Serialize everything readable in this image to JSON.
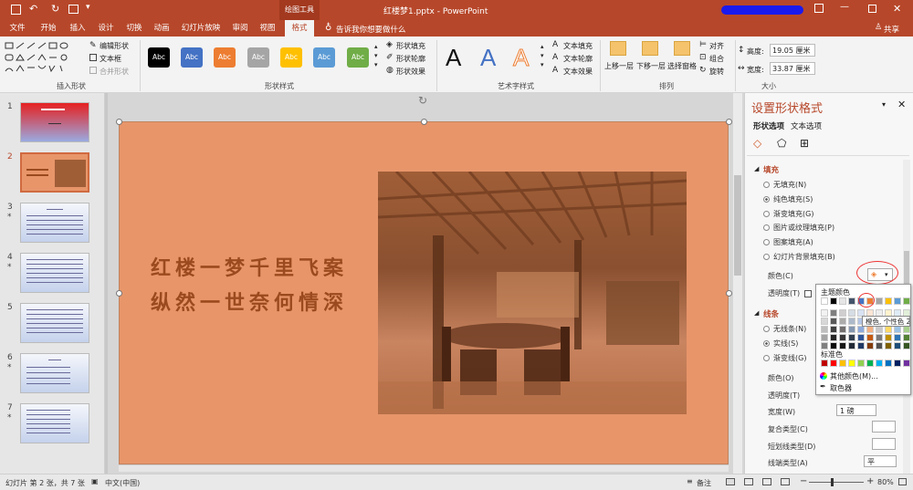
{
  "titlebar": {
    "context_tab": "绘图工具",
    "doc_title": "红楼梦1.pptx - PowerPoint",
    "sign_in": "",
    "restore_label": "大小"
  },
  "tabs": [
    {
      "label": "文件"
    },
    {
      "label": "开始"
    },
    {
      "label": "插入"
    },
    {
      "label": "设计"
    },
    {
      "label": "切换"
    },
    {
      "label": "动画"
    },
    {
      "label": "幻灯片放映"
    },
    {
      "label": "审阅"
    },
    {
      "label": "视图"
    },
    {
      "label": "格式"
    }
  ],
  "tell_me": "告诉我你想要做什么",
  "share": "共享",
  "ribbon": {
    "insert_shapes": {
      "label": "插入形状",
      "edit_shape": "编辑形状",
      "text_box": "文本框",
      "merge_shapes": "合并形状"
    },
    "shape_styles": {
      "label": "形状样式",
      "swatch_text": "Abc",
      "fill": "形状填充",
      "outline": "形状轮廓",
      "effects": "形状效果"
    },
    "wordart": {
      "label": "艺术字样式",
      "letter": "A",
      "text_fill": "文本填充",
      "text_outline": "文本轮廓",
      "text_effects": "文本效果"
    },
    "arrange": {
      "label": "排列",
      "bring_forward": "上移一层",
      "send_backward": "下移一层",
      "selection_pane": "选择窗格",
      "align": "对齐",
      "group": "组合",
      "rotate": "旋转"
    },
    "size": {
      "label": "大小",
      "height_label": "高度:",
      "height_value": "19.05 厘米",
      "width_label": "宽度:",
      "width_value": "33.87 厘米"
    }
  },
  "slides": [
    {
      "num": "1",
      "star": ""
    },
    {
      "num": "2",
      "star": ""
    },
    {
      "num": "3",
      "star": "*"
    },
    {
      "num": "4",
      "star": "*"
    },
    {
      "num": "5",
      "star": ""
    },
    {
      "num": "6",
      "star": "*"
    },
    {
      "num": "7",
      "star": "*"
    }
  ],
  "slide_content": {
    "line1": "红楼一梦千里飞案",
    "line2": "纵然一世奈何情深"
  },
  "format_pane": {
    "title": "设置形状格式",
    "tab_shape": "形状选项",
    "tab_text": "文本选项",
    "fill_section": "填充",
    "fill_options": [
      "无填充(N)",
      "纯色填充(S)",
      "渐变填充(G)",
      "图片或纹理填充(P)",
      "图案填充(A)",
      "幻灯片背景填充(B)"
    ],
    "color_label": "颜色(C)",
    "transparency_label": "透明度(T)",
    "line_section": "线条",
    "line_options": [
      "无线条(N)",
      "实线(S)",
      "渐变线(G)"
    ],
    "line_color_label": "颜色(O)",
    "line_transparency_label": "透明度(T)",
    "width_label": "宽度(W)",
    "width_value": "1 磅",
    "compound_label": "复合类型(C)",
    "dash_label": "短划线类型(D)",
    "cap_label": "线端类型(A)",
    "cap_value": "平"
  },
  "color_popup": {
    "theme_label": "主题颜色",
    "tooltip": "橙色, 个性色 2",
    "standard_label": "标准色",
    "more_colors": "其他颜色(M)...",
    "eyedropper": "取色器"
  },
  "statusbar": {
    "slide_info": "幻灯片 第 2 张，共 7 张",
    "language": "中文(中国)",
    "notes": "备注",
    "zoom": "80%"
  },
  "colors": {
    "accent": "#b7472a",
    "slide_bg": "#e8956a",
    "poem": "#9a4a1e"
  }
}
